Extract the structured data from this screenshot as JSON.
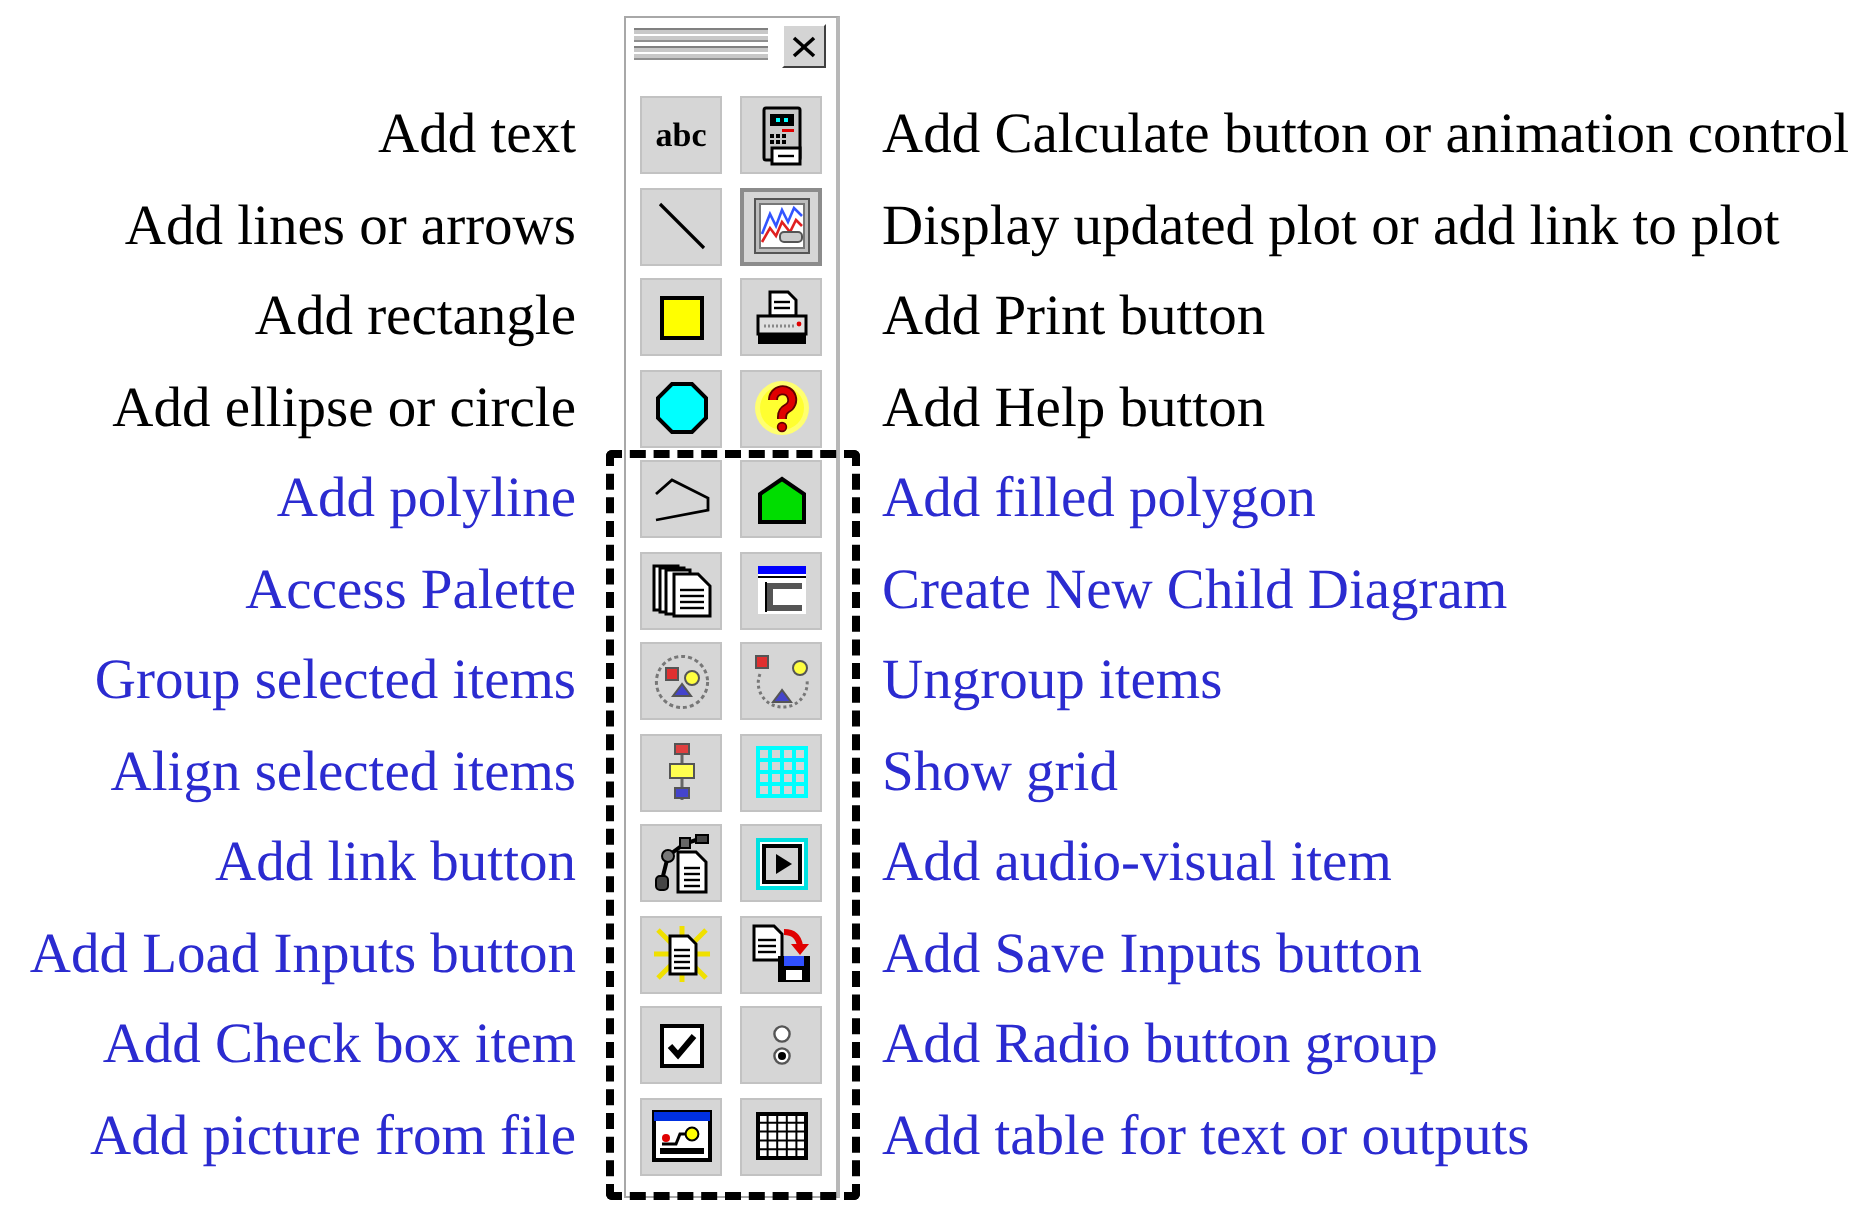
{
  "palette": {
    "groups": [
      {
        "highlighted": false,
        "rows": [
          {
            "left": {
              "label": "Add text",
              "glyph": "abc",
              "pressed": false
            },
            "right": {
              "label": "Add Calculate button or animation control",
              "pressed": false
            }
          },
          {
            "left": {
              "label": "Add lines or arrows",
              "pressed": false
            },
            "right": {
              "label": "Display updated plot or add link to plot",
              "pressed": true
            }
          },
          {
            "left": {
              "label": "Add rectangle",
              "pressed": false
            },
            "right": {
              "label": "Add Print button",
              "pressed": false
            }
          },
          {
            "left": {
              "label": "Add ellipse or circle",
              "pressed": false
            },
            "right": {
              "label": "Add Help button",
              "pressed": false
            }
          }
        ]
      },
      {
        "highlighted": true,
        "rows": [
          {
            "left": {
              "label": "Add polyline",
              "pressed": false
            },
            "right": {
              "label": "Add filled polygon",
              "pressed": false
            }
          },
          {
            "left": {
              "label": "Access Palette",
              "pressed": false
            },
            "right": {
              "label": "Create New Child Diagram",
              "pressed": false
            }
          },
          {
            "left": {
              "label": "Group selected items",
              "pressed": false
            },
            "right": {
              "label": "Ungroup items",
              "pressed": false
            }
          },
          {
            "left": {
              "label": "Align selected items",
              "pressed": false
            },
            "right": {
              "label": "Show grid",
              "pressed": false
            }
          },
          {
            "left": {
              "label": "Add link button",
              "pressed": false
            },
            "right": {
              "label": "Add audio-visual item",
              "pressed": false
            }
          },
          {
            "left": {
              "label": "Add Load Inputs button",
              "pressed": false
            },
            "right": {
              "label": "Add Save Inputs button",
              "pressed": false
            }
          },
          {
            "left": {
              "label": "Add Check box item",
              "pressed": false
            },
            "right": {
              "label": "Add Radio button group",
              "pressed": false
            }
          },
          {
            "left": {
              "label": "Add picture from file",
              "pressed": false
            },
            "right": {
              "label": "Add table for text or outputs",
              "pressed": false
            }
          }
        ]
      }
    ]
  }
}
